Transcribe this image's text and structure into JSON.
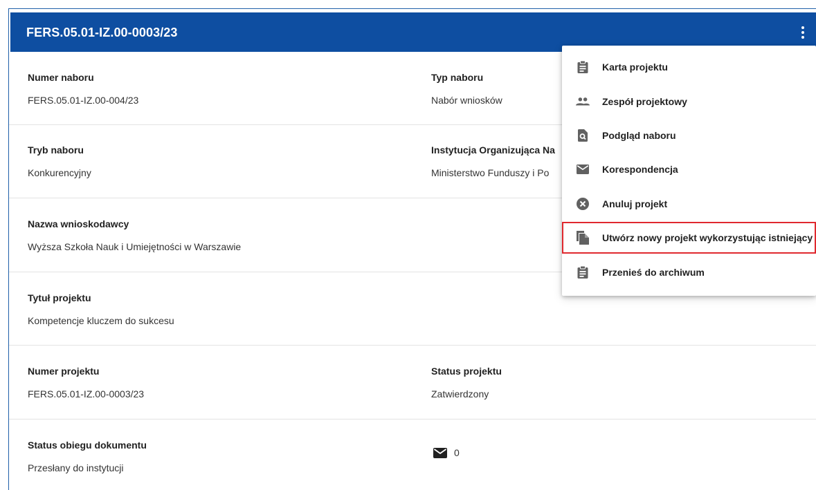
{
  "header": {
    "title": "FERS.05.01-IZ.00-0003/23",
    "menu_icon": "kebab-menu-icon"
  },
  "fields": {
    "numer_naboru": {
      "label": "Numer naboru",
      "value": "FERS.05.01-IZ.00-004/23"
    },
    "typ_naboru": {
      "label": "Typ naboru",
      "value": "Nabór wniosków"
    },
    "tryb_naboru": {
      "label": "Tryb naboru",
      "value": "Konkurencyjny"
    },
    "instytucja": {
      "label": "Instytucja Organizująca Na",
      "value": "Ministerstwo Funduszy i Po"
    },
    "nazwa_wnioskodawcy": {
      "label": "Nazwa wnioskodawcy",
      "value": "Wyższa Szkoła Nauk i Umiejętności w Warszawie"
    },
    "tytul_projektu": {
      "label": "Tytuł projektu",
      "value": "Kompetencje kluczem do sukcesu"
    },
    "numer_projektu": {
      "label": "Numer projektu",
      "value": "FERS.05.01-IZ.00-0003/23"
    },
    "status_projektu": {
      "label": "Status projektu",
      "value": "Zatwierdzony"
    },
    "status_obiegu": {
      "label": "Status obiegu dokumentu",
      "value": "Przesłany do instytucji"
    },
    "korespondencja_count": {
      "icon": "mail-icon",
      "value": "0"
    }
  },
  "menu": {
    "items": [
      {
        "label": "Karta projektu",
        "icon": "clipboard-icon"
      },
      {
        "label": "Zespół projektowy",
        "icon": "people-icon"
      },
      {
        "label": "Podgląd naboru",
        "icon": "document-search-icon"
      },
      {
        "label": "Korespondencja",
        "icon": "mail-icon"
      },
      {
        "label": "Anuluj projekt",
        "icon": "cancel-circle-icon"
      },
      {
        "label": "Utwórz nowy projekt wykorzystując istniejący",
        "icon": "copy-document-icon",
        "highlighted": true
      },
      {
        "label": "Przenieś do archiwum",
        "icon": "clipboard-icon"
      }
    ]
  },
  "colors": {
    "header_bg": "#0e4ea1",
    "highlight_border": "#e0282e",
    "icon_gray": "#616161"
  }
}
